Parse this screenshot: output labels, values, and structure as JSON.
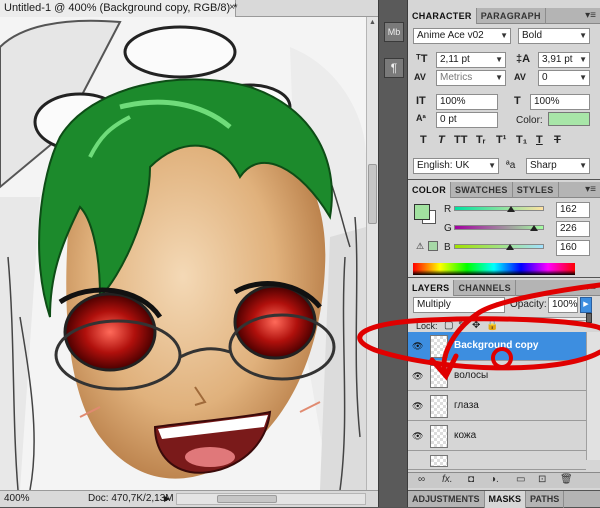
{
  "document": {
    "tab_title": "Untitled-1 @ 400% (Background copy, RGB/8) *",
    "close_glyph": "×",
    "zoom": "400%",
    "doc_info": "Doc: 470,7K/2,13M"
  },
  "dock": {
    "buttons": [
      "Mb",
      "¶"
    ]
  },
  "character_panel": {
    "tabs": [
      "CHARACTER",
      "PARAGRAPH"
    ],
    "font_family": "Anime Ace v02",
    "font_style": "Bold",
    "font_size": "2,11 pt",
    "leading": "3,91 pt",
    "kerning": "Metrics",
    "tracking": "0",
    "vertical_scale": "100%",
    "horizontal_scale": "100%",
    "baseline_shift": "0 pt",
    "color_label": "Color:",
    "text_color": "#a8e6a8",
    "format_buttons": [
      "T",
      "T",
      "TT",
      "Tᵣ",
      "T¹",
      "T₁",
      "T",
      "T"
    ],
    "language": "English: UK",
    "aa_label": "ªa",
    "antialias": "Sharp"
  },
  "color_panel": {
    "tabs": [
      "COLOR",
      "SWATCHES",
      "STYLES"
    ],
    "channels": [
      {
        "label": "R",
        "value": "162",
        "fraction": 0.635
      },
      {
        "label": "G",
        "value": "226",
        "fraction": 0.886
      },
      {
        "label": "B",
        "value": "160",
        "fraction": 0.627
      }
    ],
    "foreground": "#a2e2a0"
  },
  "layers_panel": {
    "tabs": [
      "LAYERS",
      "CHANNELS"
    ],
    "blend_mode": "Multiply",
    "opacity_label": "Opacity:",
    "opacity": "100%",
    "lock_label": "Lock:",
    "layers": [
      {
        "name": "Background copy",
        "selected": true
      },
      {
        "name": "волосы",
        "selected": false
      },
      {
        "name": "глаза",
        "selected": false
      },
      {
        "name": "кожа",
        "selected": false
      }
    ],
    "bottom_icons": [
      "∞",
      "fx.",
      "◘",
      "◑.",
      "▭",
      "⊡",
      "🗑"
    ]
  },
  "bottom_tabs": [
    "ADJUSTMENTS",
    "MASKS",
    "PATHS"
  ],
  "colors": {
    "selection_blue": "#3d8ee0",
    "annotation_red": "#e00000"
  }
}
